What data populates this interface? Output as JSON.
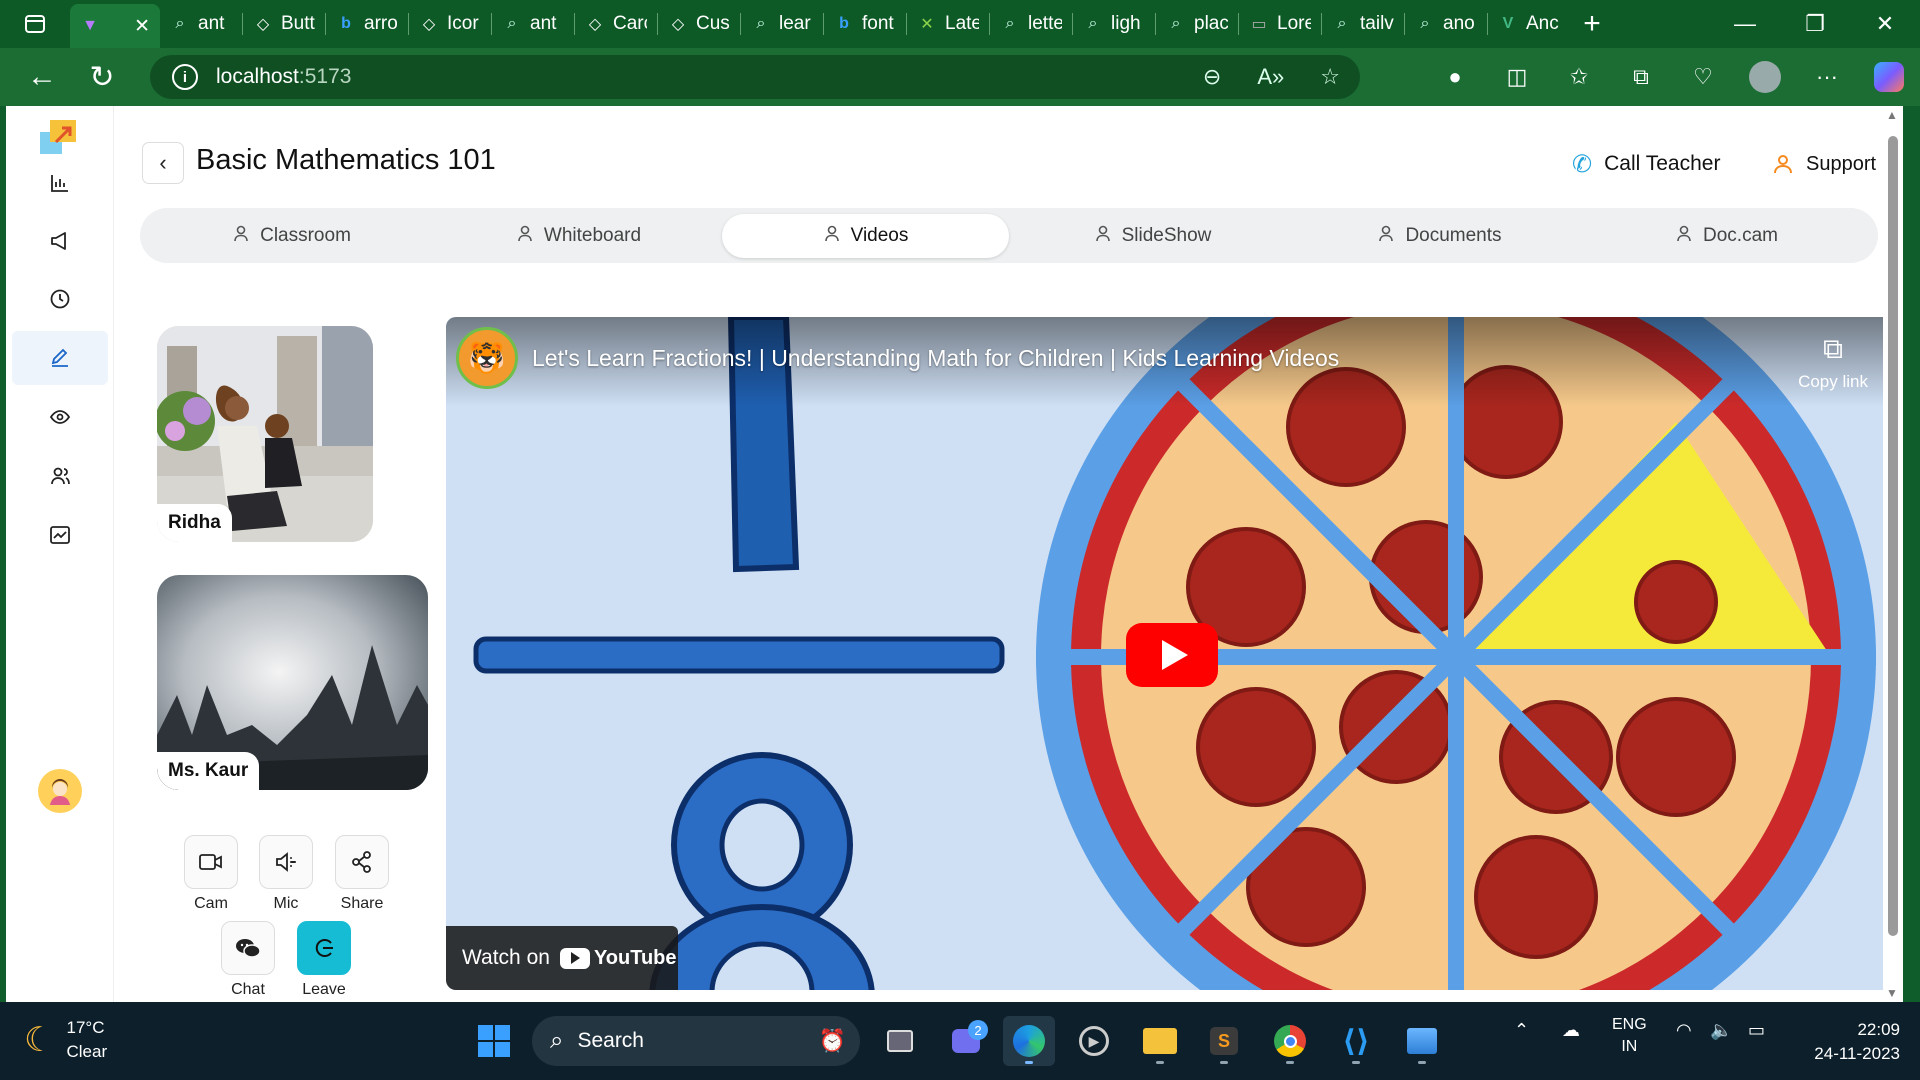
{
  "browser": {
    "tabs": [
      {
        "icon": "vite-icon",
        "title": ""
      },
      {
        "icon": "search-icon",
        "title": "ant"
      },
      {
        "icon": "codepen-icon",
        "title": "Butt"
      },
      {
        "icon": "bing-icon",
        "title": "arro"
      },
      {
        "icon": "codepen-icon",
        "title": "Icor"
      },
      {
        "icon": "search-icon",
        "title": "ant"
      },
      {
        "icon": "codepen-icon",
        "title": "Carc"
      },
      {
        "icon": "codepen-icon",
        "title": "Cus"
      },
      {
        "icon": "search-icon",
        "title": "lear"
      },
      {
        "icon": "bing-icon",
        "title": "font"
      },
      {
        "icon": "latex-icon",
        "title": "Late"
      },
      {
        "icon": "search-icon",
        "title": "lette"
      },
      {
        "icon": "search-icon",
        "title": "ligh"
      },
      {
        "icon": "search-icon",
        "title": "plac"
      },
      {
        "icon": "page-icon",
        "title": "Lore"
      },
      {
        "icon": "search-icon",
        "title": "tailv"
      },
      {
        "icon": "search-icon",
        "title": "ano"
      },
      {
        "icon": "vue-icon",
        "title": "Anc"
      }
    ],
    "url_host": "localhost",
    "url_port": ":5173"
  },
  "app": {
    "title": "Basic Mathematics 101",
    "call_teacher": "Call Teacher",
    "support": "Support",
    "tabs": [
      {
        "label": "Classroom",
        "active": false
      },
      {
        "label": "Whiteboard",
        "active": false
      },
      {
        "label": "Videos",
        "active": true
      },
      {
        "label": "SlideShow",
        "active": false
      },
      {
        "label": "Documents",
        "active": false
      },
      {
        "label": "Doc.cam",
        "active": false
      }
    ],
    "participants": [
      "Ridha",
      "Ms. Kaur"
    ],
    "controls": {
      "cam": "Cam",
      "mic": "Mic",
      "share": "Share",
      "chat": "Chat",
      "leave": "Leave"
    },
    "sidebar_icons": [
      "bar-chart-icon",
      "megaphone-icon",
      "clock-icon",
      "edit-icon",
      "eye-icon",
      "users-icon",
      "line-chart-icon"
    ],
    "accent_color": "#1a66c9",
    "leave_color": "#16bcd3"
  },
  "video": {
    "title": "Let's Learn Fractions! | Understanding Math for Children | Kids Learning Videos",
    "copy_link": "Copy link",
    "watch_on": "Watch on",
    "youtube": "YouTube"
  },
  "taskbar": {
    "temperature": "17°C",
    "condition": "Clear",
    "search": "Search",
    "chat_badge": "2",
    "lang": "ENG",
    "region": "IN",
    "time": "22:09",
    "date": "24-11-2023"
  }
}
